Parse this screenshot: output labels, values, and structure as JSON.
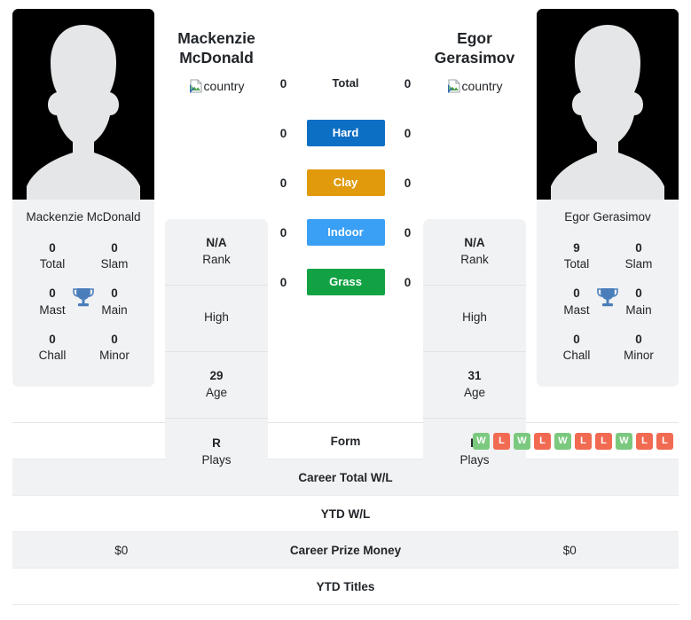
{
  "players": {
    "left": {
      "display_name": "Mackenzie\nMcDonald",
      "name_line1": "Mackenzie",
      "name_line2": "McDonald",
      "panel_name": "Mackenzie McDonald",
      "country_alt": "country",
      "titles": {
        "total_value": "0",
        "total_label": "Total",
        "slam_value": "0",
        "slam_label": "Slam",
        "mast_value": "0",
        "mast_label": "Mast",
        "main_value": "0",
        "main_label": "Main",
        "chall_value": "0",
        "chall_label": "Chall",
        "minor_value": "0",
        "minor_label": "Minor"
      },
      "stats": {
        "rank_value": "N/A",
        "rank_label": "Rank",
        "high_value": "High",
        "age_value": "29",
        "age_label": "Age",
        "plays_value": "R",
        "plays_label": "Plays"
      }
    },
    "right": {
      "display_name": "Egor\nGerasimov",
      "name_line1": "Egor",
      "name_line2": "Gerasimov",
      "panel_name": "Egor Gerasimov",
      "country_alt": "country",
      "titles": {
        "total_value": "9",
        "total_label": "Total",
        "slam_value": "0",
        "slam_label": "Slam",
        "mast_value": "0",
        "mast_label": "Mast",
        "main_value": "0",
        "main_label": "Main",
        "chall_value": "0",
        "chall_label": "Chall",
        "minor_value": "0",
        "minor_label": "Minor"
      },
      "stats": {
        "rank_value": "N/A",
        "rank_label": "Rank",
        "high_value": "High",
        "age_value": "31",
        "age_label": "Age",
        "plays_value": "R",
        "plays_label": "Plays"
      }
    }
  },
  "h2h_surfaces": [
    {
      "label": "Total",
      "left": "0",
      "right": "0",
      "color": "none",
      "plain": true
    },
    {
      "label": "Hard",
      "left": "0",
      "right": "0",
      "color": "#0d6fc4",
      "plain": false
    },
    {
      "label": "Clay",
      "left": "0",
      "right": "0",
      "color": "#e09a0b",
      "plain": false
    },
    {
      "label": "Indoor",
      "left": "0",
      "right": "0",
      "color": "#3aa0f5",
      "plain": false
    },
    {
      "label": "Grass",
      "left": "0",
      "right": "0",
      "color": "#12a244",
      "plain": false
    }
  ],
  "comparison_rows": [
    {
      "label": "Form",
      "left": "",
      "right": "",
      "shaded": false,
      "form": [
        "W",
        "L",
        "W",
        "L",
        "W",
        "L",
        "L",
        "W",
        "L",
        "L"
      ]
    },
    {
      "label": "Career Total W/L",
      "left": "",
      "right": "",
      "shaded": true,
      "form": null
    },
    {
      "label": "YTD W/L",
      "left": "",
      "right": "",
      "shaded": false,
      "form": null
    },
    {
      "label": "Career Prize Money",
      "left": "$0",
      "right": "$0",
      "shaded": true,
      "form": null
    },
    {
      "label": "YTD Titles",
      "left": "",
      "right": "",
      "shaded": false,
      "form": null
    }
  ],
  "colors": {
    "win_badge": "#7bc97f",
    "loss_badge": "#f16a52",
    "trophy": "#4a7ebb",
    "card_bg": "#f1f2f3",
    "photo_bg": "#000000",
    "silhouette": "#e4e6e7"
  }
}
